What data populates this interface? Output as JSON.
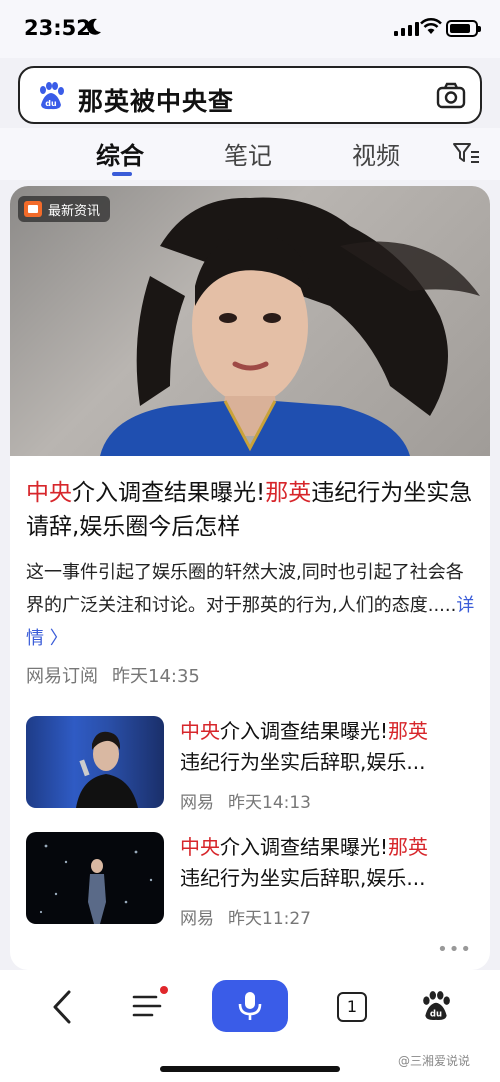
{
  "status_bar": {
    "time": "23:52"
  },
  "search": {
    "query": "那英被中央查"
  },
  "tabs": [
    {
      "label": "综合",
      "active": true
    },
    {
      "label": "笔记",
      "active": false
    },
    {
      "label": "视频",
      "active": false
    }
  ],
  "featured": {
    "badge": "最新资讯",
    "headline_part1": "中央",
    "headline_part2": "介入调查结果曝光!",
    "headline_part3": "那英",
    "headline_part4": "违纪行为坐实急请辞,娱乐圈今后怎样",
    "summary": "这一事件引起了娱乐圈的轩然大波,同时也引起了社会各界的广泛关注和讨论。对于那英的行为,人们的态度.....",
    "detail_link": "详情 〉",
    "source": "网易订阅",
    "time": "昨天14:35"
  },
  "items": [
    {
      "title_red1": "中央",
      "title_mid": "介入调查结果曝光!",
      "title_red2": "那英",
      "title_line2": "违纪行为坐实后辞职,娱乐...",
      "source": "网易",
      "time": "昨天14:13"
    },
    {
      "title_red1": "中央",
      "title_mid": "介入调查结果曝光!",
      "title_red2": "那英",
      "title_line2": "违纪行为坐实后辞职,娱乐...",
      "source": "网易",
      "time": "昨天11:27"
    }
  ],
  "bottom_nav": {
    "tab_count": "1"
  },
  "watermark": "@三湘爱说说",
  "colors": {
    "accent": "#3a5ce8",
    "highlight": "#d7262b"
  }
}
